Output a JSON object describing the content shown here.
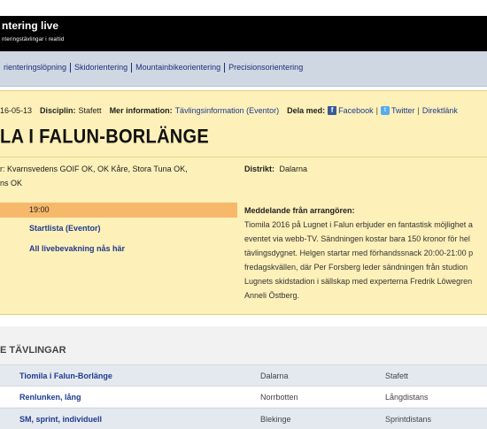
{
  "header": {
    "app_title": "ntering live",
    "app_subtitle": "nteringstävlingar i realtid"
  },
  "nav": {
    "items": [
      {
        "label": "rienteringslöpning"
      },
      {
        "label": "Skidorientering"
      },
      {
        "label": "Mountainbikeorientering"
      },
      {
        "label": "Precisionsorientering"
      }
    ]
  },
  "event": {
    "date": "16-05-13",
    "discipline_label": "Disciplin:",
    "discipline_value": "Stafett",
    "more_info_label": "Mer information:",
    "more_info_link": "Tävlingsinformation (Eventor)",
    "share_label": "Dela med:",
    "share_facebook": "Facebook",
    "share_twitter": "Twitter",
    "share_direct": "Direktlänk",
    "title": "LA I FALUN-BORLÄNGE",
    "organizers_line1": "r: Kvarnsvedens GOIF OK, OK Kåre, Stora Tuna OK,",
    "organizers_line2": "ns OK",
    "district_label": "Distrikt:",
    "district_value": "Dalarna",
    "start_time": "19:00",
    "startlist_link": "Startlista (Eventor)",
    "all_live_link": "All livebevakning nås här",
    "message_title": "Meddelande från arrangören:",
    "message_lines": [
      "Tiomila 2016 på Lugnet i Falun erbjuder en fantastisk möjlighet a",
      "eventet via webb-TV. Sändningen kostar bara 150 kronor för hel",
      "tävlingsdygnet. Helgen startar med förhandssnack 20:00-21:00 p",
      "fredagskvällen, där Per Forsberg leder sändningen från studion",
      "Lugnets skidstadion i sällskap med experterna Fredrik Löwegren",
      "Anneli Östberg."
    ]
  },
  "competitions": {
    "title": "E TÄVLINGAR",
    "rows": [
      {
        "name": "Tiomila i Falun-Borlänge",
        "district": "Dalarna",
        "discipline": "Stafett"
      },
      {
        "name": "Renlunken, lång",
        "district": "Norrbotten",
        "discipline": "Långdistans"
      },
      {
        "name": "SM, sprint, individuell",
        "district": "Blekinge",
        "discipline": "Sprintdistans"
      }
    ]
  },
  "colors": {
    "header_bg": "#000000",
    "nav_bg": "#cfd7e3",
    "panel_bg": "#fdf0b8",
    "time_bar": "#f6b86a",
    "link": "#1f3a8f",
    "row_alt": "#e4e9f0"
  }
}
